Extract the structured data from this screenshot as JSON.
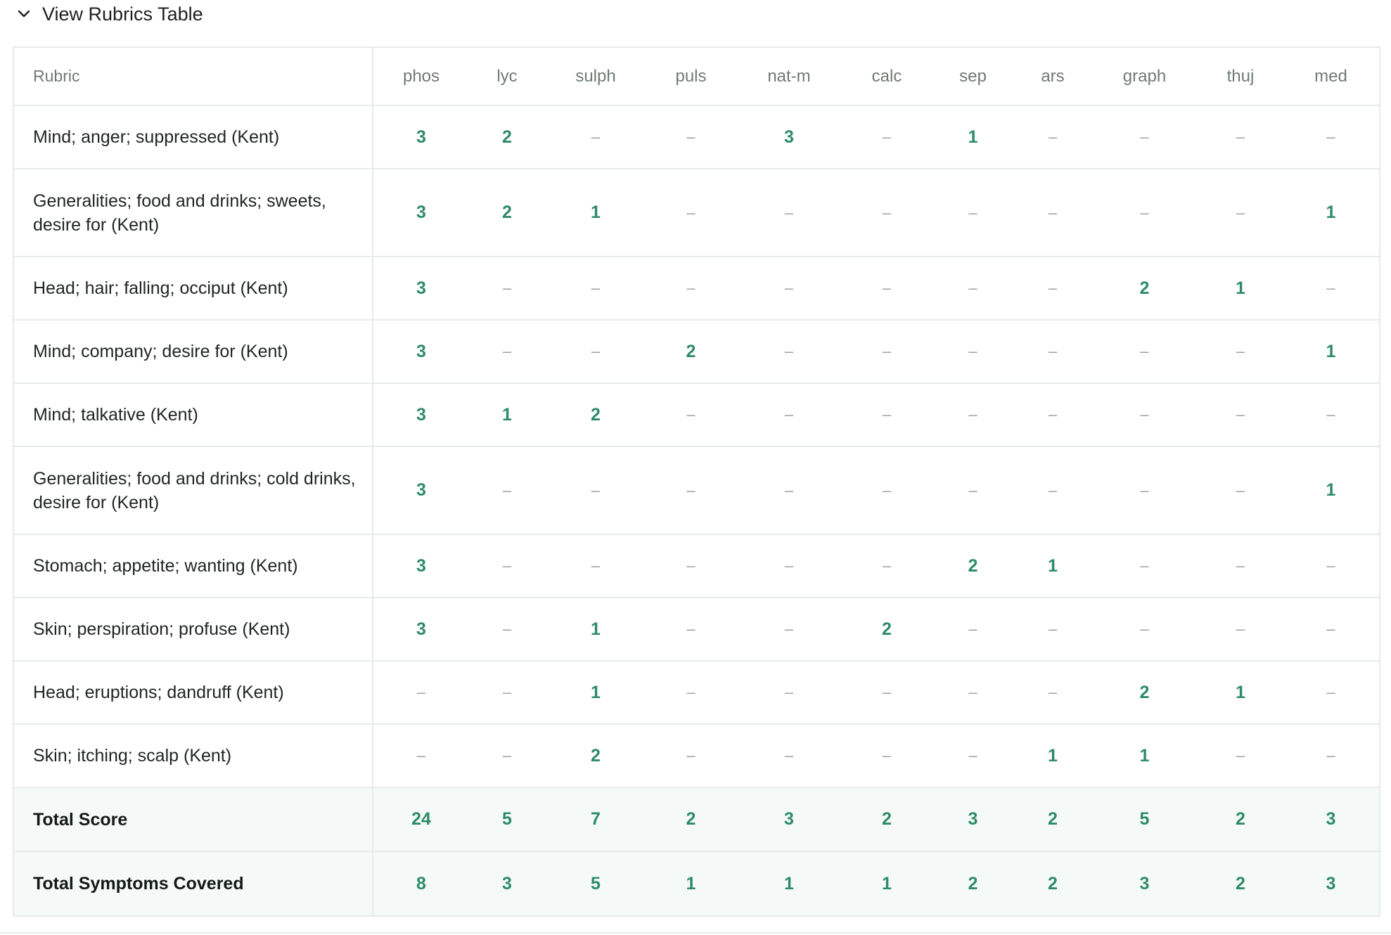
{
  "header": {
    "title": "View Rubrics Table",
    "toggle_icon": "chevron-down-icon"
  },
  "table": {
    "columns": [
      "Rubric",
      "phos",
      "lyc",
      "sulph",
      "puls",
      "nat-m",
      "calc",
      "sep",
      "ars",
      "graph",
      "thuj",
      "med"
    ],
    "rows": [
      {
        "rubric": "Mind; anger; suppressed (Kent)",
        "values": [
          "3",
          "2",
          "–",
          "–",
          "3",
          "–",
          "1",
          "–",
          "–",
          "–",
          "–"
        ]
      },
      {
        "rubric": "Generalities; food and drinks; sweets, desire for (Kent)",
        "values": [
          "3",
          "2",
          "1",
          "–",
          "–",
          "–",
          "–",
          "–",
          "–",
          "–",
          "1"
        ]
      },
      {
        "rubric": "Head; hair; falling; occiput (Kent)",
        "values": [
          "3",
          "–",
          "–",
          "–",
          "–",
          "–",
          "–",
          "–",
          "2",
          "1",
          "–"
        ]
      },
      {
        "rubric": "Mind; company; desire for (Kent)",
        "values": [
          "3",
          "–",
          "–",
          "2",
          "–",
          "–",
          "–",
          "–",
          "–",
          "–",
          "1"
        ]
      },
      {
        "rubric": "Mind; talkative (Kent)",
        "values": [
          "3",
          "1",
          "2",
          "–",
          "–",
          "–",
          "–",
          "–",
          "–",
          "–",
          "–"
        ]
      },
      {
        "rubric": "Generalities; food and drinks; cold drinks, desire for (Kent)",
        "values": [
          "3",
          "–",
          "–",
          "–",
          "–",
          "–",
          "–",
          "–",
          "–",
          "–",
          "1"
        ]
      },
      {
        "rubric": "Stomach; appetite; wanting (Kent)",
        "values": [
          "3",
          "–",
          "–",
          "–",
          "–",
          "–",
          "2",
          "1",
          "–",
          "–",
          "–"
        ]
      },
      {
        "rubric": "Skin; perspiration; profuse (Kent)",
        "values": [
          "3",
          "–",
          "1",
          "–",
          "–",
          "2",
          "–",
          "–",
          "–",
          "–",
          "–"
        ]
      },
      {
        "rubric": "Head; eruptions; dandruff (Kent)",
        "values": [
          "–",
          "–",
          "1",
          "–",
          "–",
          "–",
          "–",
          "–",
          "2",
          "1",
          "–"
        ]
      },
      {
        "rubric": "Skin; itching; scalp (Kent)",
        "values": [
          "–",
          "–",
          "2",
          "–",
          "–",
          "–",
          "–",
          "1",
          "1",
          "–",
          "–"
        ]
      }
    ],
    "totals": [
      {
        "label": "Total Score",
        "values": [
          "24",
          "5",
          "7",
          "2",
          "3",
          "2",
          "3",
          "2",
          "5",
          "2",
          "3"
        ]
      },
      {
        "label": "Total Symptoms Covered",
        "values": [
          "8",
          "3",
          "5",
          "1",
          "1",
          "1",
          "2",
          "2",
          "3",
          "2",
          "3"
        ]
      }
    ]
  },
  "colors": {
    "accent_green": "#2e8b66",
    "muted_dash": "#9aa39e",
    "border": "#e6ebe8",
    "total_row_bg": "#f5faf8"
  }
}
